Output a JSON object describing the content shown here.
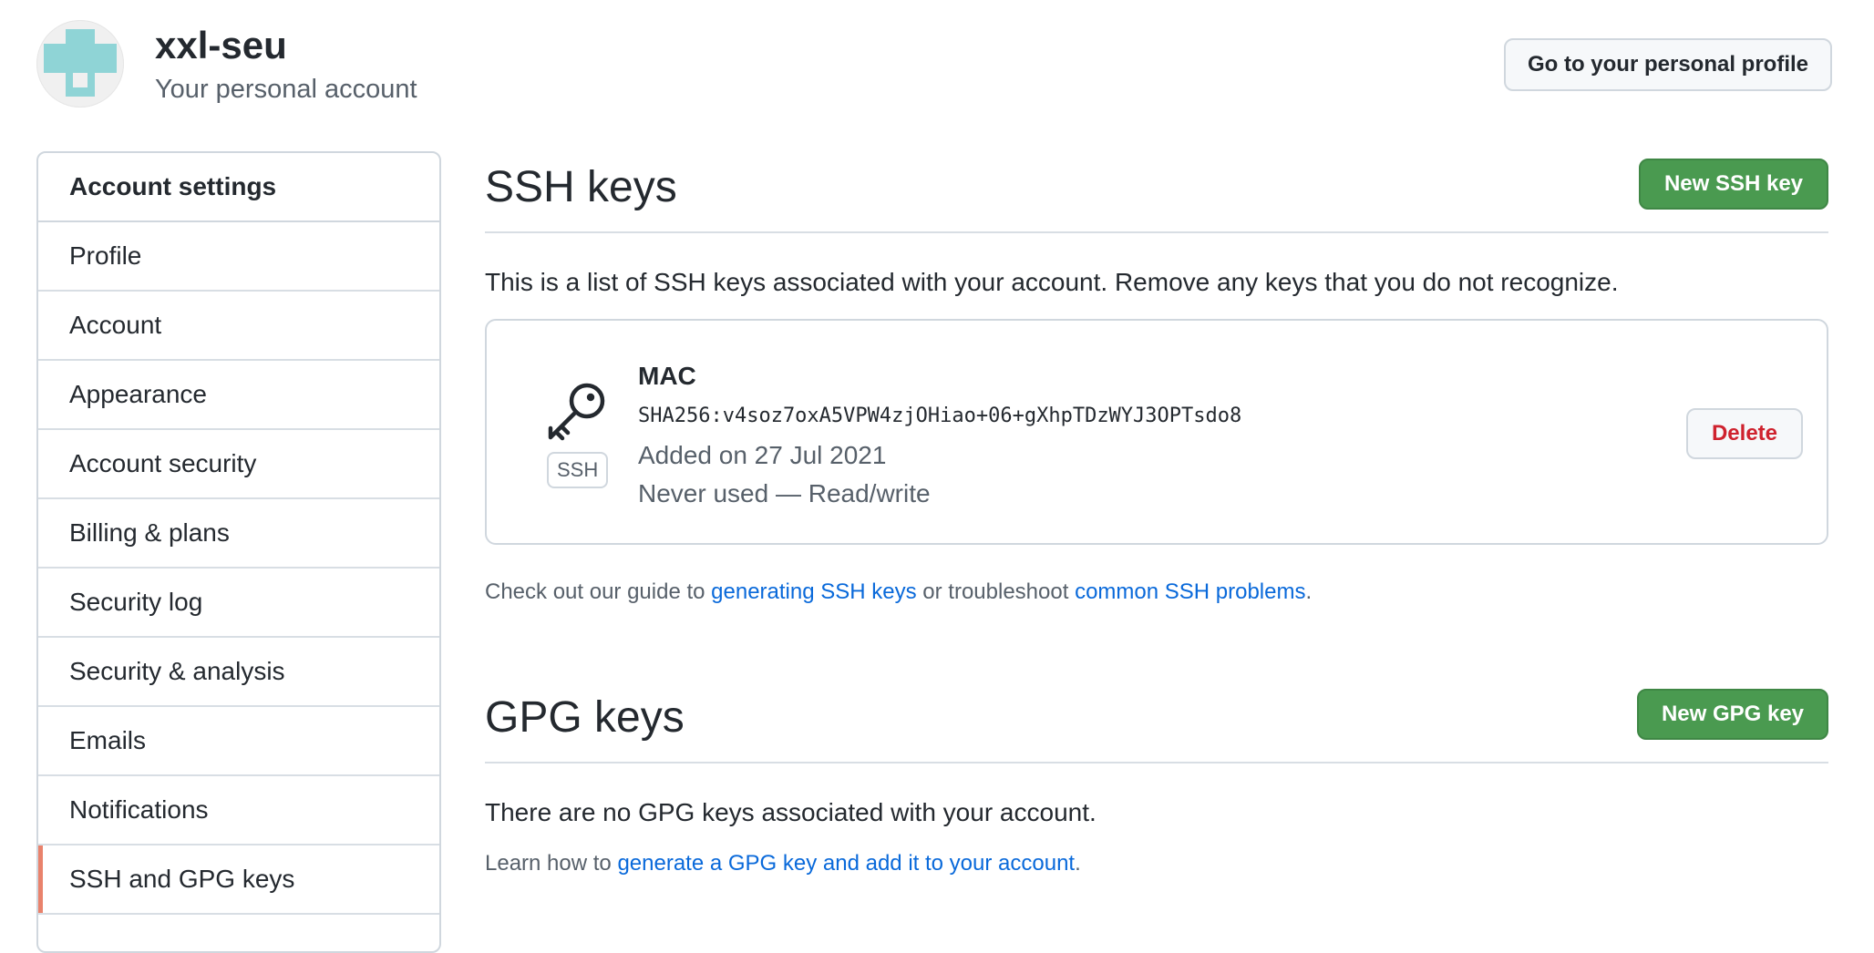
{
  "header": {
    "account_name": "xxl-seu",
    "account_subtitle": "Your personal account",
    "profile_button": "Go to your personal profile"
  },
  "sidebar": {
    "heading": "Account settings",
    "items": [
      {
        "label": "Profile"
      },
      {
        "label": "Account"
      },
      {
        "label": "Appearance"
      },
      {
        "label": "Account security"
      },
      {
        "label": "Billing & plans"
      },
      {
        "label": "Security log"
      },
      {
        "label": "Security & analysis"
      },
      {
        "label": "Emails"
      },
      {
        "label": "Notifications"
      },
      {
        "label": "SSH and GPG keys",
        "selected": true
      }
    ]
  },
  "ssh": {
    "title": "SSH keys",
    "new_button": "New SSH key",
    "description": "This is a list of SSH keys associated with your account. Remove any keys that you do not recognize.",
    "key": {
      "name": "MAC",
      "fingerprint": "SHA256:v4soz7oxA5VPW4zjOHiao+06+gXhpTDzWYJ3OPTsdo8",
      "added": "Added on 27 Jul 2021",
      "usage": "Never used — Read/write",
      "type_label": "SSH",
      "delete_button": "Delete"
    },
    "guide": {
      "prefix": "Check out our guide to ",
      "link1": "generating SSH keys",
      "middle": " or troubleshoot ",
      "link2": "common SSH problems",
      "suffix": "."
    }
  },
  "gpg": {
    "title": "GPG keys",
    "new_button": "New GPG key",
    "description": "There are no GPG keys associated with your account.",
    "learn": {
      "prefix": "Learn how to ",
      "link": "generate a GPG key and add it to your account",
      "suffix": "."
    }
  },
  "colors": {
    "primary_button": "#4a9a50",
    "link": "#0969da",
    "danger": "#cf222e",
    "selected_indicator": "#e9826c",
    "avatar": "#8fd4d6"
  },
  "icons": {
    "avatar": "identicon-avatar",
    "key": "key-icon"
  }
}
